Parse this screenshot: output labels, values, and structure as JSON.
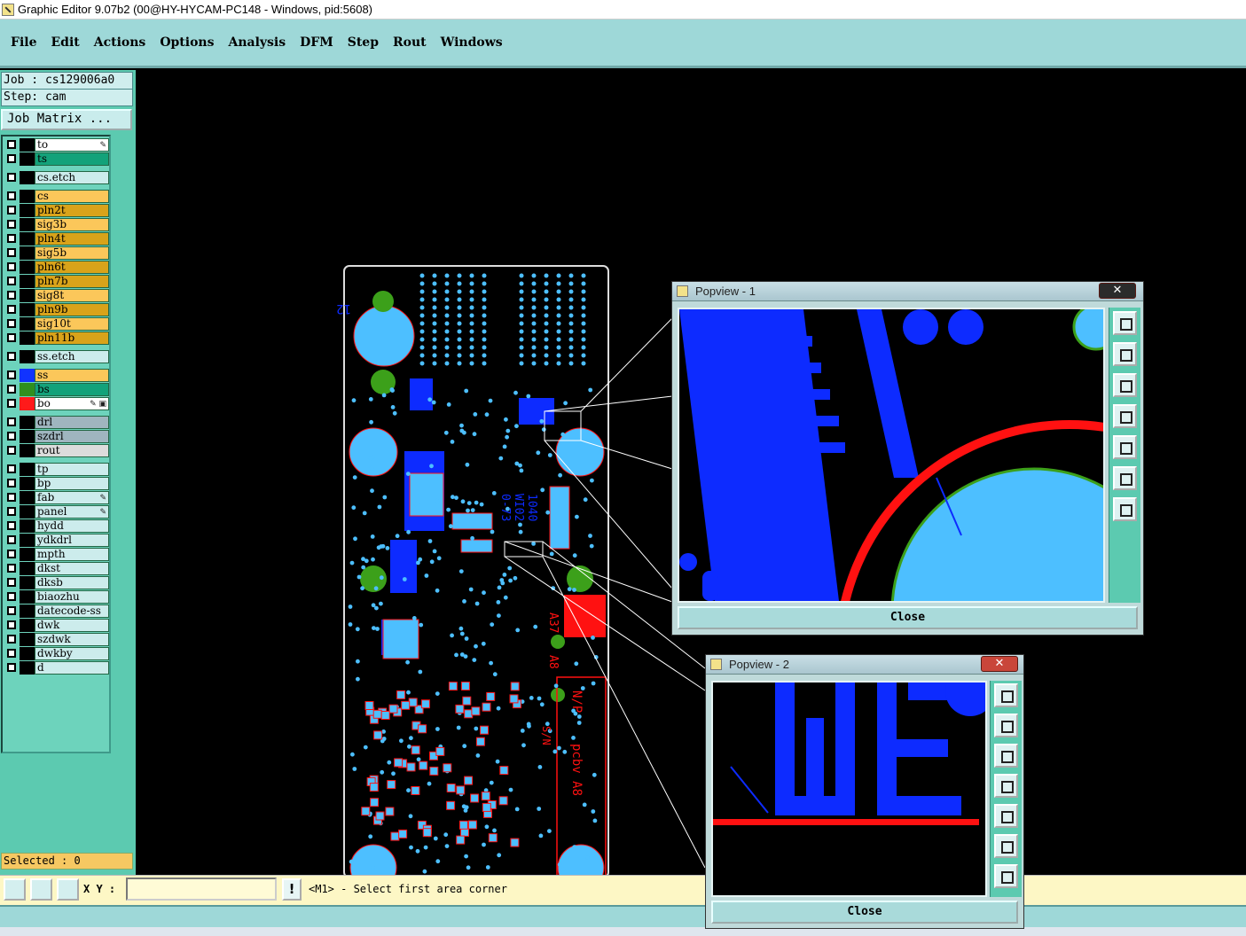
{
  "window": {
    "title": "Graphic Editor 9.07b2 (00@HY-HYCAM-PC148 - Windows, pid:5608)"
  },
  "menu": [
    "File",
    "Edit",
    "Actions",
    "Options",
    "Analysis",
    "DFM",
    "Step",
    "Rout",
    "Windows"
  ],
  "job": {
    "job_label": "Job : cs129006a0",
    "step_label": "Step: cam",
    "matrix_button": "Job Matrix ..."
  },
  "layers": [
    {
      "name": "to",
      "color": "#ffffff",
      "swatch": "#000000",
      "mark": "✎"
    },
    {
      "name": "ts",
      "color": "#13a27a",
      "swatch": "#000000",
      "mark": ""
    },
    {
      "name": "cs.etch",
      "color": "#ccecec",
      "swatch": "#000000",
      "mark": ""
    },
    {
      "name": "cs",
      "color": "#fbc75a",
      "swatch": "#000000",
      "mark": ""
    },
    {
      "name": "pln2t",
      "color": "#d9a31a",
      "swatch": "#000000",
      "mark": ""
    },
    {
      "name": "sig3b",
      "color": "#fbc75a",
      "swatch": "#000000",
      "mark": ""
    },
    {
      "name": "pln4t",
      "color": "#d9a31a",
      "swatch": "#000000",
      "mark": ""
    },
    {
      "name": "sig5b",
      "color": "#fbc75a",
      "swatch": "#000000",
      "mark": ""
    },
    {
      "name": "pln6t",
      "color": "#d9a31a",
      "swatch": "#000000",
      "mark": ""
    },
    {
      "name": "pln7b",
      "color": "#d9a31a",
      "swatch": "#000000",
      "mark": ""
    },
    {
      "name": "sig8t",
      "color": "#fbc75a",
      "swatch": "#000000",
      "mark": ""
    },
    {
      "name": "pln9b",
      "color": "#d9a31a",
      "swatch": "#000000",
      "mark": ""
    },
    {
      "name": "sig10t",
      "color": "#fbc75a",
      "swatch": "#000000",
      "mark": ""
    },
    {
      "name": "pln11b",
      "color": "#d9a31a",
      "swatch": "#000000",
      "mark": ""
    },
    {
      "name": "ss.etch",
      "color": "#ccecec",
      "swatch": "#000000",
      "mark": ""
    },
    {
      "name": "ss",
      "color": "#fbc75a",
      "swatch": "#1133ff",
      "mark": ""
    },
    {
      "name": "bs",
      "color": "#13a27a",
      "swatch": "#2f8f1f",
      "mark": ""
    },
    {
      "name": "bo",
      "color": "#ffffff",
      "swatch": "#ff1a1a",
      "mark": "✎ ▣"
    },
    {
      "name": "drl",
      "color": "#9fb5bf",
      "swatch": "#000000",
      "mark": ""
    },
    {
      "name": "szdrl",
      "color": "#9fb5bf",
      "swatch": "#000000",
      "mark": ""
    },
    {
      "name": "rout",
      "color": "#dcdcdc",
      "swatch": "#000000",
      "mark": ""
    },
    {
      "name": "tp",
      "color": "#ccecec",
      "swatch": "#000000",
      "mark": ""
    },
    {
      "name": "bp",
      "color": "#ccecec",
      "swatch": "#000000",
      "mark": ""
    },
    {
      "name": "fab",
      "color": "#ccecec",
      "swatch": "#000000",
      "mark": "✎"
    },
    {
      "name": "panel",
      "color": "#ccecec",
      "swatch": "#000000",
      "mark": "✎"
    },
    {
      "name": "hydd",
      "color": "#ccecec",
      "swatch": "#000000",
      "mark": ""
    },
    {
      "name": "ydkdrl",
      "color": "#ccecec",
      "swatch": "#000000",
      "mark": ""
    },
    {
      "name": "mpth",
      "color": "#ccecec",
      "swatch": "#000000",
      "mark": ""
    },
    {
      "name": "dkst",
      "color": "#ccecec",
      "swatch": "#000000",
      "mark": ""
    },
    {
      "name": "dksb",
      "color": "#ccecec",
      "swatch": "#000000",
      "mark": ""
    },
    {
      "name": "biaozhu",
      "color": "#ccecec",
      "swatch": "#000000",
      "mark": ""
    },
    {
      "name": "datecode-ss",
      "color": "#ccecec",
      "swatch": "#000000",
      "mark": ""
    },
    {
      "name": "dwk",
      "color": "#ccecec",
      "swatch": "#000000",
      "mark": ""
    },
    {
      "name": "szdwk",
      "color": "#ccecec",
      "swatch": "#000000",
      "mark": ""
    },
    {
      "name": "dwkby",
      "color": "#ccecec",
      "swatch": "#000000",
      "mark": ""
    },
    {
      "name": "d",
      "color": "#ccecec",
      "swatch": "#000000",
      "mark": ""
    }
  ],
  "selected": "Selected : 0",
  "status": {
    "xy_label": "X Y :",
    "xy_value": "",
    "warn": "!",
    "prompt": "<M1> - Select first area corner"
  },
  "popview1": {
    "title": "Popview - 1",
    "close_x": "✕",
    "close_button": "Close"
  },
  "popview2": {
    "title": "Popview - 2",
    "close_x": "✕",
    "close_button": "Close"
  },
  "board": {
    "labels": {
      "n12": "12",
      "a37": "A37",
      "a8": "A8",
      "code1": "1040",
      "code2": "WI02",
      "code3": "0-73",
      "code4": "pcbv A8",
      "code5": "N/P",
      "code6": "S/N"
    }
  },
  "colors": {
    "cyan_pad": "#4dbfff",
    "blue": "#0d2bff",
    "red": "#ff1111",
    "green": "#3ca01a",
    "board_outline": "#dddddd",
    "panel_bg": "#5ccab0",
    "menu_bg": "#9ed8d8"
  }
}
